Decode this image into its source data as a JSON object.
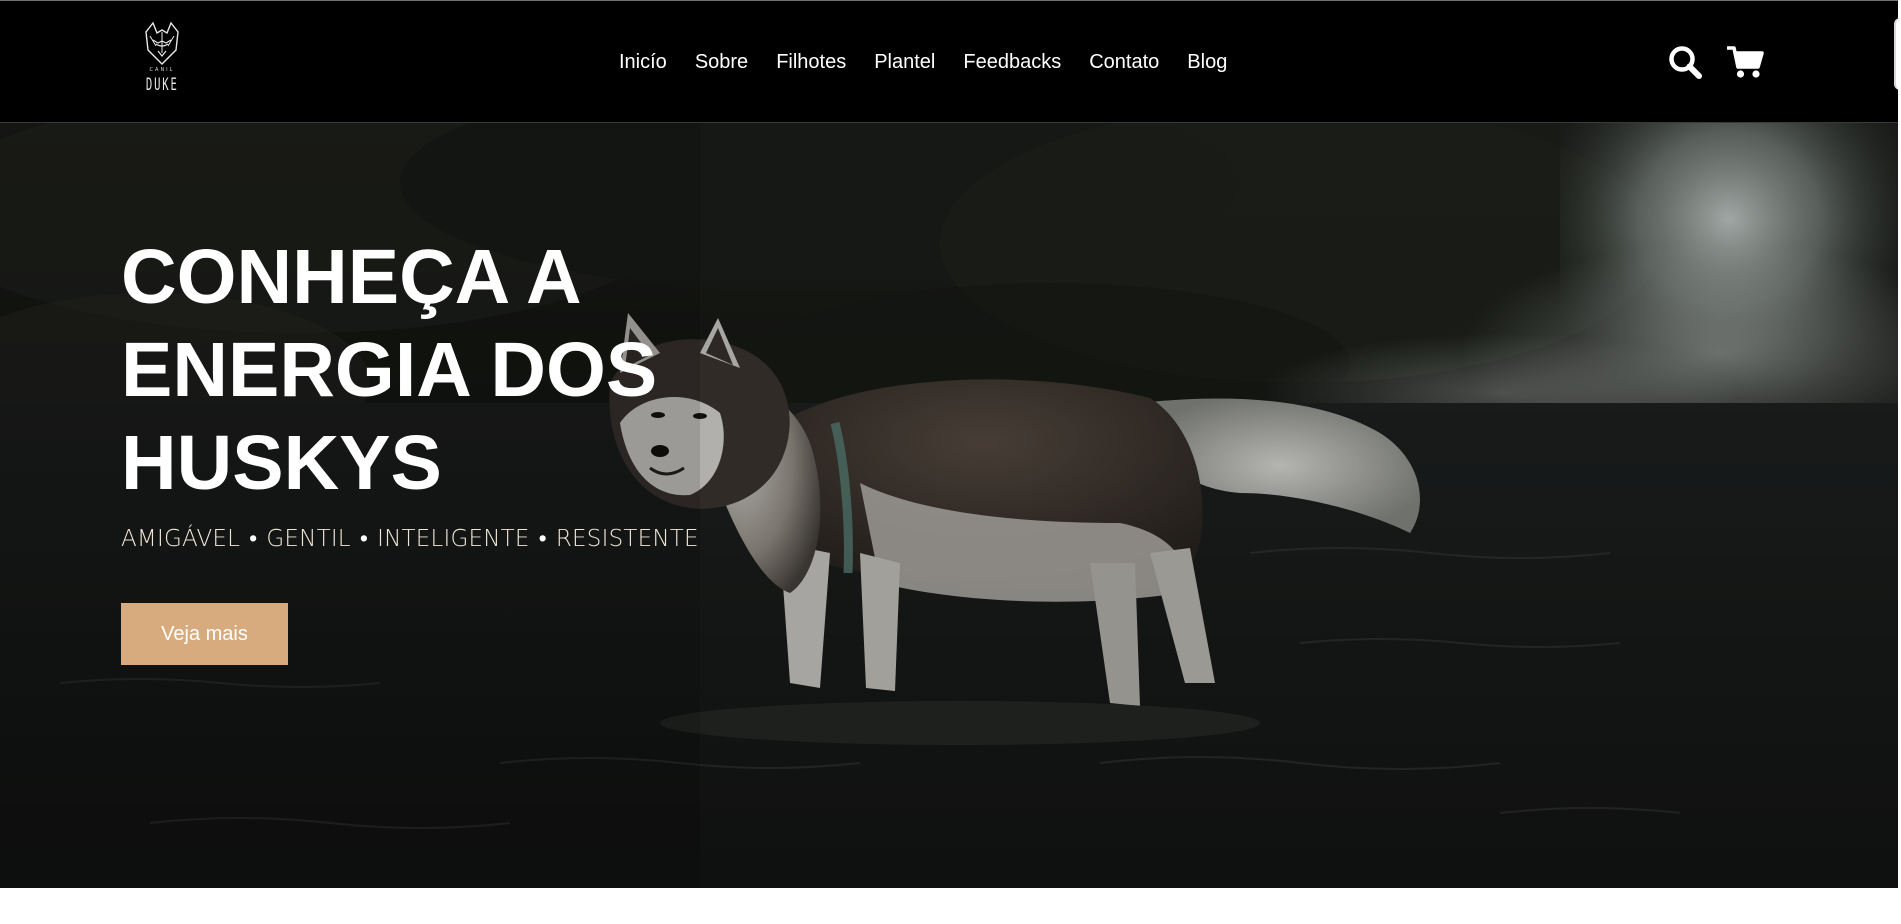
{
  "header": {
    "logo": {
      "small_text": "CANIL",
      "big_text": "DUKE",
      "icon": "husky-head-icon"
    },
    "nav": [
      {
        "label": "Inicío"
      },
      {
        "label": "Sobre"
      },
      {
        "label": "Filhotes"
      },
      {
        "label": "Plantel"
      },
      {
        "label": "Feedbacks"
      },
      {
        "label": "Contato"
      },
      {
        "label": "Blog"
      }
    ],
    "icons": [
      "search-icon",
      "cart-icon"
    ]
  },
  "hero": {
    "title_lines": [
      "CONHEÇA A",
      "ENERGIA DOS",
      "HUSKYS"
    ],
    "tagline": [
      "AMIGÁVEL",
      "GENTIL",
      "INTELIGENTE",
      "RESISTENTE"
    ],
    "separator": "•",
    "cta_label": "Veja mais",
    "image_subject": "husky-in-river-photo"
  },
  "colors": {
    "header_bg": "#000000",
    "accent": "#d8ab7e",
    "text_light": "#ffffff",
    "tagline": "#f1e6d8"
  }
}
